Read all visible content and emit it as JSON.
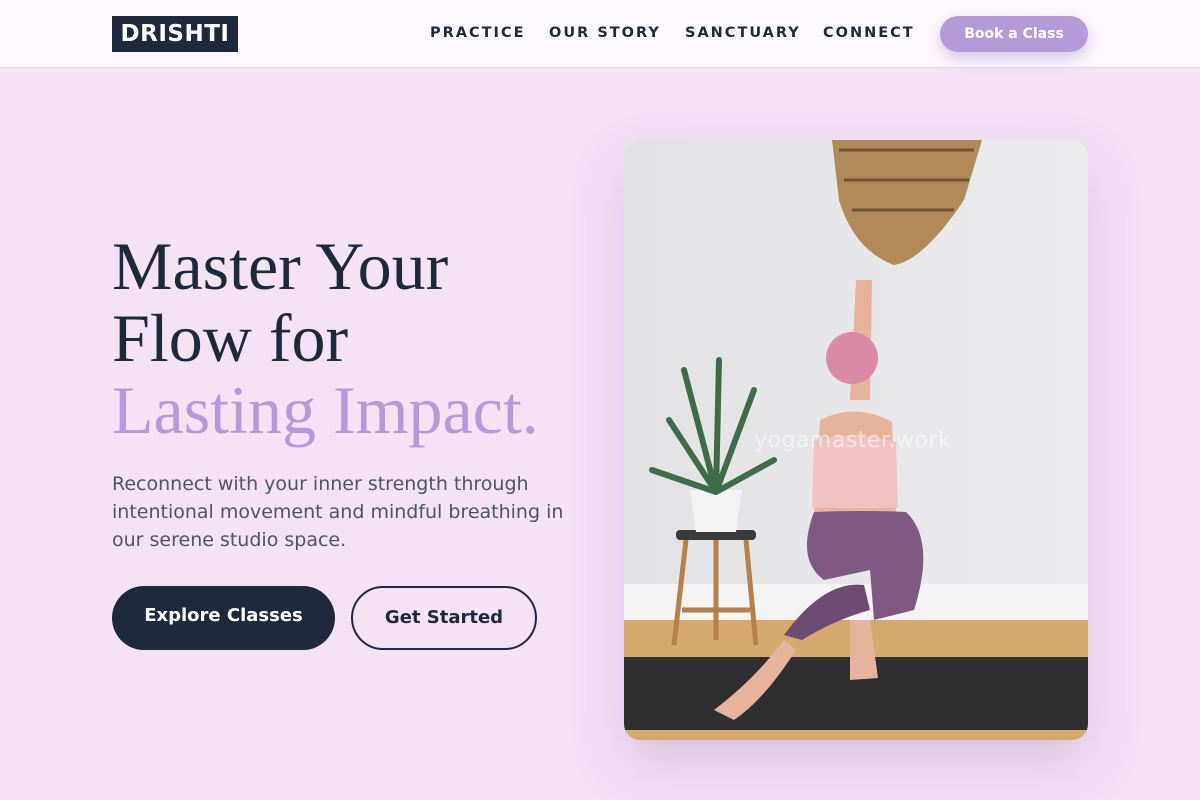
{
  "brand": {
    "logo": "DRISHTI"
  },
  "nav": {
    "items": [
      {
        "label": "PRACTICE"
      },
      {
        "label": "OUR STORY"
      },
      {
        "label": "SANCTUARY"
      },
      {
        "label": "CONNECT"
      }
    ],
    "cta": "Book a Class"
  },
  "hero": {
    "headline_line1": "Master Your",
    "headline_line2": "Flow for",
    "headline_accent": "Lasting Impact.",
    "subtext": "Reconnect with your inner strength through intentional movement and mindful breathing in our serene studio space.",
    "primary_button": "Explore Classes",
    "secondary_button": "Get Started",
    "image_watermark": "yogamaster.work"
  },
  "colors": {
    "background": "#f3e3f5",
    "dark": "#1e293b",
    "accent": "#b49ad9"
  }
}
